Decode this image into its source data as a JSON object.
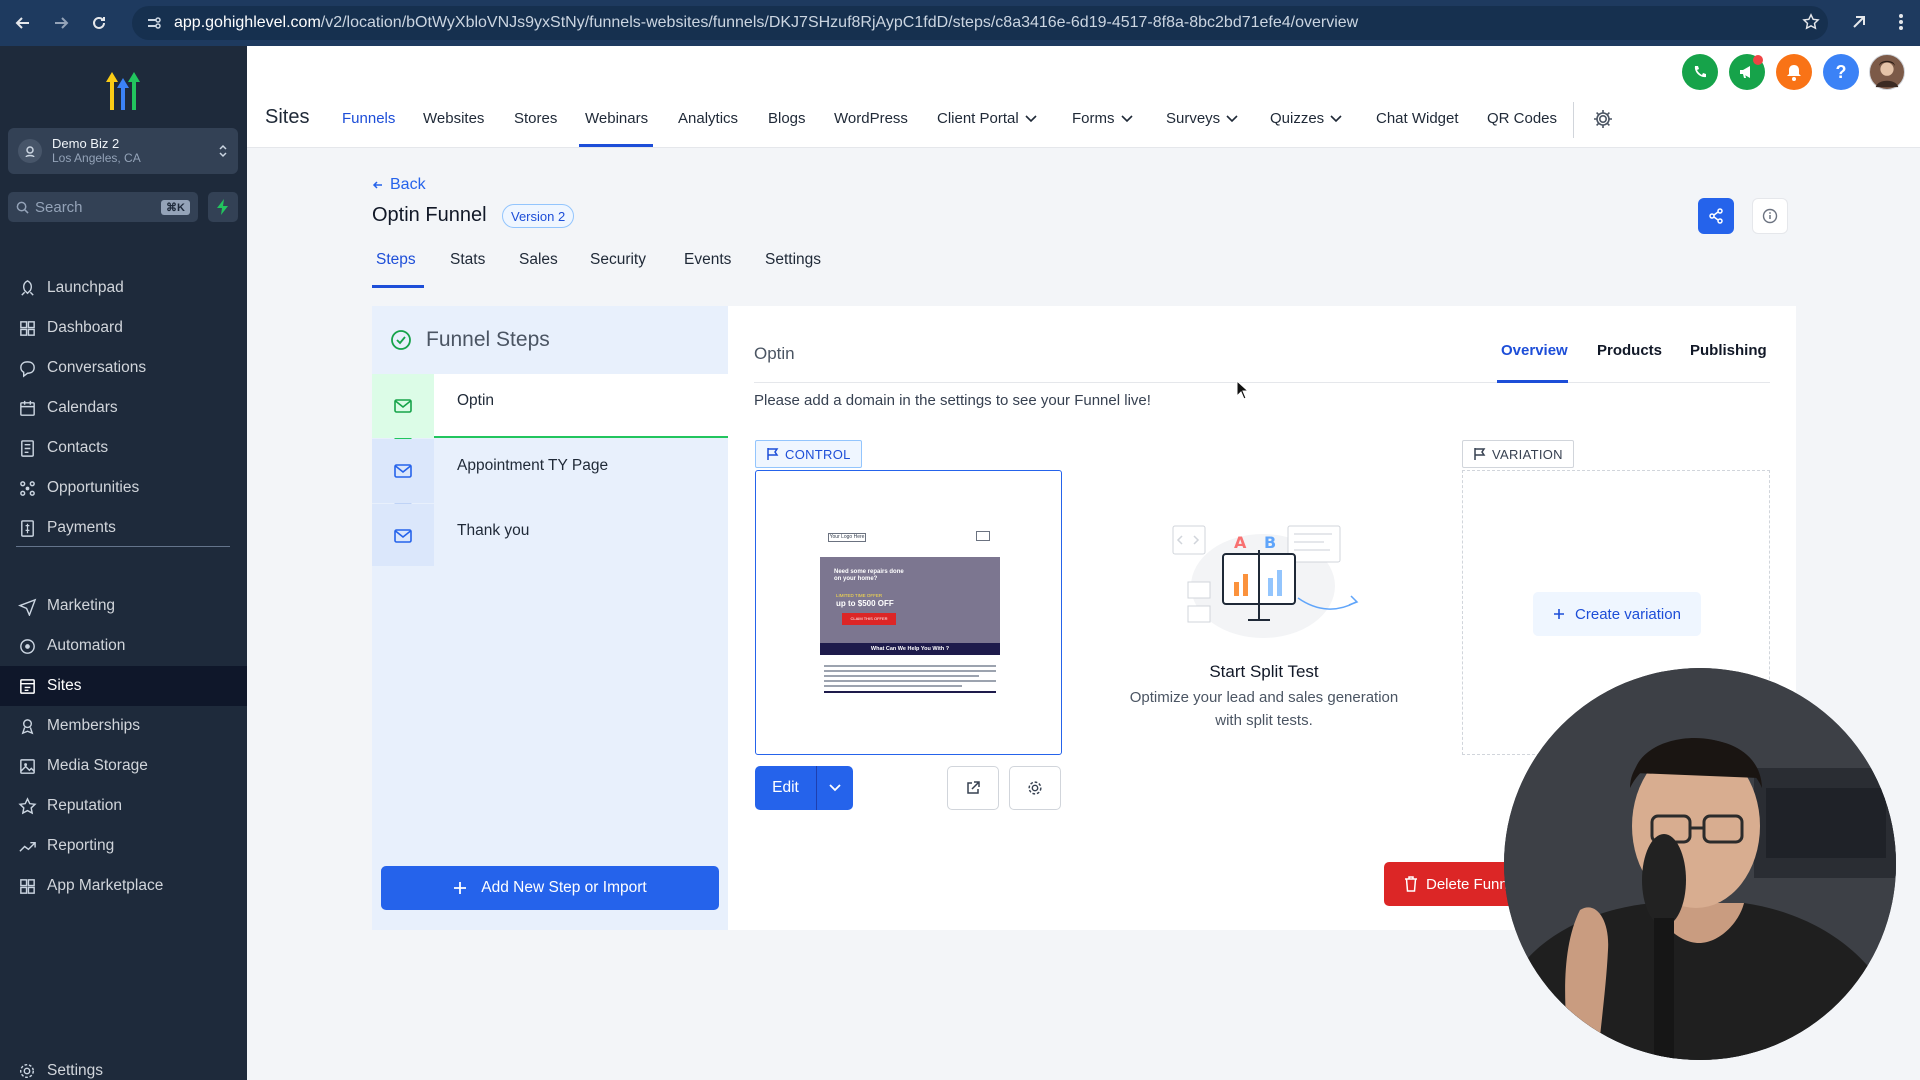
{
  "browser": {
    "url_host": "app.gohighlevel.com",
    "url_path": "/v2/location/bOtWyXbloVNJs9yxStNy/funnels-websites/funnels/DKJ7SHzuf8RjAypC1fdD/steps/c8a3416e-6d19-4517-8f8a-8bc2bd71efe4/overview"
  },
  "sidebar": {
    "account_name": "Demo Biz 2",
    "account_location": "Los Angeles, CA",
    "search_placeholder": "Search",
    "search_shortcut": "⌘K",
    "items": [
      {
        "label": "Launchpad",
        "icon": "rocket-icon"
      },
      {
        "label": "Dashboard",
        "icon": "dashboard-icon"
      },
      {
        "label": "Conversations",
        "icon": "chat-icon"
      },
      {
        "label": "Calendars",
        "icon": "calendar-icon"
      },
      {
        "label": "Contacts",
        "icon": "contacts-icon"
      },
      {
        "label": "Opportunities",
        "icon": "opportunities-icon"
      },
      {
        "label": "Payments",
        "icon": "payments-icon"
      }
    ],
    "items2": [
      {
        "label": "Marketing",
        "icon": "send-icon"
      },
      {
        "label": "Automation",
        "icon": "automation-icon"
      },
      {
        "label": "Sites",
        "icon": "sites-icon"
      },
      {
        "label": "Memberships",
        "icon": "memberships-icon"
      },
      {
        "label": "Media Storage",
        "icon": "image-icon"
      },
      {
        "label": "Reputation",
        "icon": "star-icon"
      },
      {
        "label": "Reporting",
        "icon": "trend-icon"
      },
      {
        "label": "App Marketplace",
        "icon": "grid-icon"
      }
    ],
    "settings_label": "Settings",
    "active_item": "Sites"
  },
  "topnav": {
    "section_title": "Sites",
    "tabs": [
      "Funnels",
      "Websites",
      "Stores",
      "Webinars",
      "Analytics",
      "Blogs",
      "WordPress",
      "Client Portal",
      "Forms",
      "Surveys",
      "Quizzes",
      "Chat Widget",
      "QR Codes"
    ],
    "active_tab": "Funnels"
  },
  "funnel": {
    "back_label": "Back",
    "title": "Optin Funnel",
    "version_badge": "Version 2",
    "tabs": [
      "Steps",
      "Stats",
      "Sales",
      "Security",
      "Events",
      "Settings"
    ],
    "active_tab": "Steps"
  },
  "steps_panel": {
    "title": "Funnel Steps",
    "steps": [
      "Optin",
      "Appointment TY Page",
      "Thank you"
    ],
    "selected_step": "Optin",
    "add_button": "Add New Step or Import"
  },
  "step_detail": {
    "title": "Optin",
    "tabs": [
      "Overview",
      "Products",
      "Publishing"
    ],
    "active_tab": "Overview",
    "notice": "Please add a domain in the settings to see your Funnel live!",
    "control_tag": "CONTROL",
    "variation_tag": "VARIATION",
    "edit_label": "Edit",
    "split_title": "Start Split Test",
    "split_desc_line1": "Optimize your lead and sales generation",
    "split_desc_line2": "with split tests.",
    "create_variation": "Create variation",
    "delete_label": "Delete Funnel"
  },
  "preview": {
    "logo_text": "Your Logo Here",
    "headline": "Need some repairs done on your home?",
    "offer_small": "LIMITED TIME OFFER",
    "offer_big": "up to $500 OFF",
    "cta": "CLAIM THIS OFFER",
    "section_heading": "What Can We Help You With ?"
  },
  "colors": {
    "primary": "#2563eb",
    "sidebar_bg": "#1e2a3b",
    "success": "#22c55e",
    "danger": "#dc2626"
  }
}
